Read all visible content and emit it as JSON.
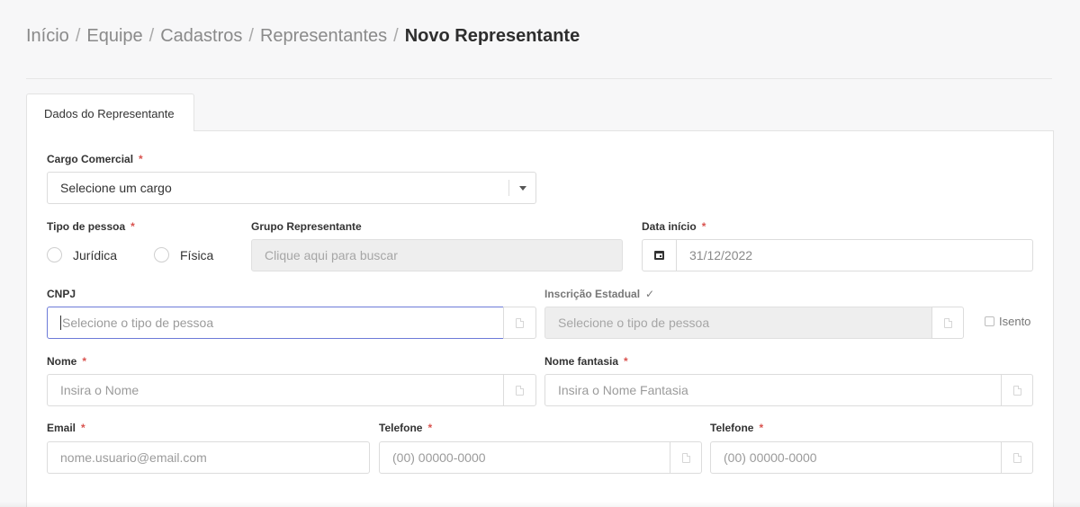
{
  "breadcrumb": {
    "items": [
      "Início",
      "Equipe",
      "Cadastros",
      "Representantes"
    ],
    "separator": "/",
    "current": "Novo Representante"
  },
  "tab": {
    "label": "Dados do Representante"
  },
  "form": {
    "required_mark": "*",
    "cargo": {
      "label": "Cargo Comercial",
      "value": "Selecione um cargo"
    },
    "tipo_pessoa": {
      "label": "Tipo de pessoa",
      "options": [
        "Jurídica",
        "Física"
      ]
    },
    "grupo": {
      "label": "Grupo Representante",
      "placeholder": "Clique aqui para buscar"
    },
    "data_inicio": {
      "label": "Data início",
      "value": "31/12/2022"
    },
    "cnpj": {
      "label": "CNPJ",
      "placeholder": "Selecione o tipo de pessoa"
    },
    "inscricao": {
      "label": "Inscrição Estadual",
      "check": "✓",
      "placeholder": "Selecione o tipo de pessoa",
      "isento_label": "Isento"
    },
    "nome": {
      "label": "Nome",
      "placeholder": "Insira o Nome"
    },
    "nome_fantasia": {
      "label": "Nome fantasia",
      "placeholder": "Insira o Nome Fantasia"
    },
    "email": {
      "label": "Email",
      "placeholder": "nome.usuario@email.com"
    },
    "telefone1": {
      "label": "Telefone",
      "placeholder": "(00) 00000-0000"
    },
    "telefone2": {
      "label": "Telefone",
      "placeholder": "(00) 00000-0000"
    }
  },
  "colors": {
    "required": "#d9534f",
    "focus_border": "#6d7bd8",
    "disabled_bg": "#eeeeee"
  },
  "icons": [
    "caret-down-icon",
    "calendar-icon",
    "document-icon",
    "check-icon"
  ]
}
